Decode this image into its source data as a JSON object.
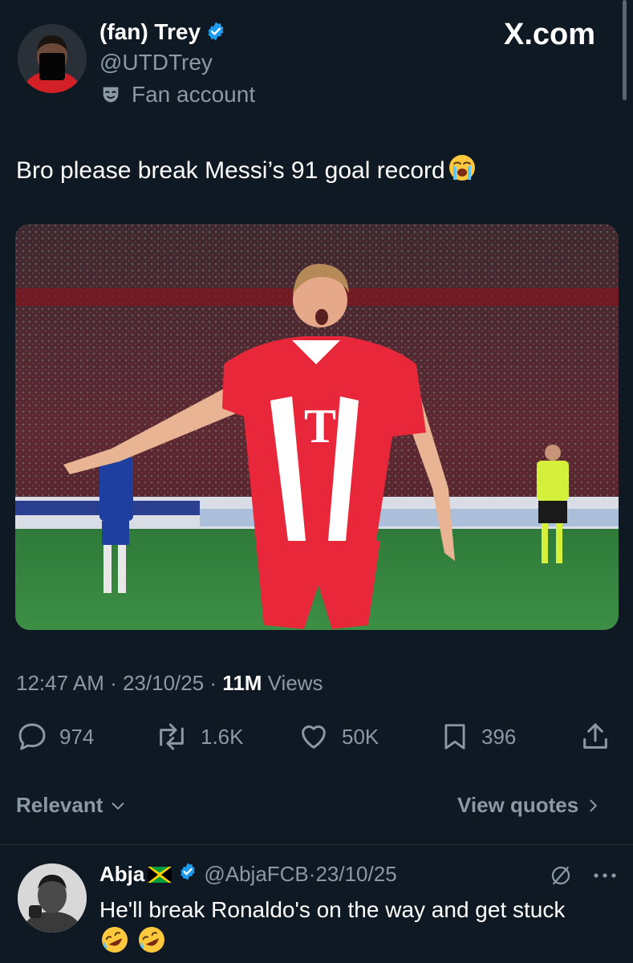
{
  "post": {
    "display_name": "(fan) Trey",
    "handle": "@UTDTrey",
    "fan_label": "Fan account",
    "brand": "X.com",
    "text": "Bro please break Messi’s 91 goal record",
    "time": "12:47 AM",
    "sep1": " · ",
    "date": "23/10/25",
    "sep2": " · ",
    "views_count": "11M",
    "views_label": " Views"
  },
  "media": {
    "shirt_letter": "T"
  },
  "actions": {
    "replies": "974",
    "reposts": "1.6K",
    "likes": "50K",
    "bookmarks": "396"
  },
  "filters": {
    "sort_label": "Relevant",
    "view_quotes": "View quotes"
  },
  "reply": {
    "name": "Abja",
    "handle": "@AbjaFCB",
    "sep": " · ",
    "date": "23/10/25",
    "text": "He'll break Ronaldo's on the way and get stuck"
  },
  "icons": {
    "verified": "verified-badge-icon",
    "fan": "theater-mask-icon",
    "reply": "speech-bubble-icon",
    "repost": "repost-icon",
    "like": "heart-icon",
    "bookmark": "bookmark-icon",
    "share": "share-icon",
    "more": "more-icon",
    "grok": "grok-icon"
  },
  "colors": {
    "background": "#0f1923",
    "muted": "#8b98a5",
    "verified": "#1d9bf0"
  }
}
